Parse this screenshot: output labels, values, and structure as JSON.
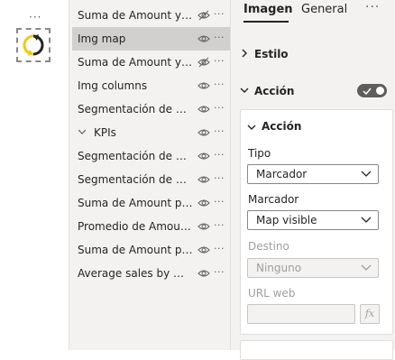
{
  "left_strip": {
    "more_label": "···",
    "visual_icon": "bookmark-refresh-icon"
  },
  "selection_pane": {
    "items": [
      {
        "label": "Suma de Amount y Su...",
        "visibility": "hidden-eye"
      },
      {
        "label": "Img map",
        "visibility": "visible-eye",
        "selected": true
      },
      {
        "label": "Suma de Amount y Su...",
        "visibility": "hidden-eye"
      },
      {
        "label": "Img columns",
        "visibility": "visible-eye"
      },
      {
        "label": "Segmentación de datos",
        "visibility": "visible-eye"
      },
      {
        "label": "KPIs",
        "visibility": "visible-eye",
        "group": true
      },
      {
        "label": "Segmentación de datos",
        "visibility": "visible-eye"
      },
      {
        "label": "Segmentación de datos",
        "visibility": "visible-eye"
      },
      {
        "label": "Suma de Amount por ...",
        "visibility": "visible-eye"
      },
      {
        "label": "Promedio de Amount ...",
        "visibility": "visible-eye"
      },
      {
        "label": "Suma de Amount por ...",
        "visibility": "visible-eye"
      },
      {
        "label": "Average sales by mari...",
        "visibility": "visible-eye"
      }
    ],
    "more_label": "···"
  },
  "format_pane": {
    "tabs": [
      "Imagen",
      "General"
    ],
    "more_label": "···",
    "sections": {
      "estilo": "Estilo",
      "accion": "Acción"
    },
    "action_toggle_on": true,
    "card": {
      "title": "Acción",
      "tipo_label": "Tipo",
      "tipo_value": "Marcador",
      "marcador_label": "Marcador",
      "marcador_value": "Map visible",
      "destino_label": "Destino",
      "destino_value": "Ninguno",
      "url_label": "URL web",
      "url_value": "",
      "fx_label": "fx"
    }
  },
  "colors": {
    "accent_yellow": "#f2c811",
    "toggle_bg": "#605e5c",
    "selected_row": "#d2d0ce",
    "pane_bg": "#f3f2f1"
  }
}
